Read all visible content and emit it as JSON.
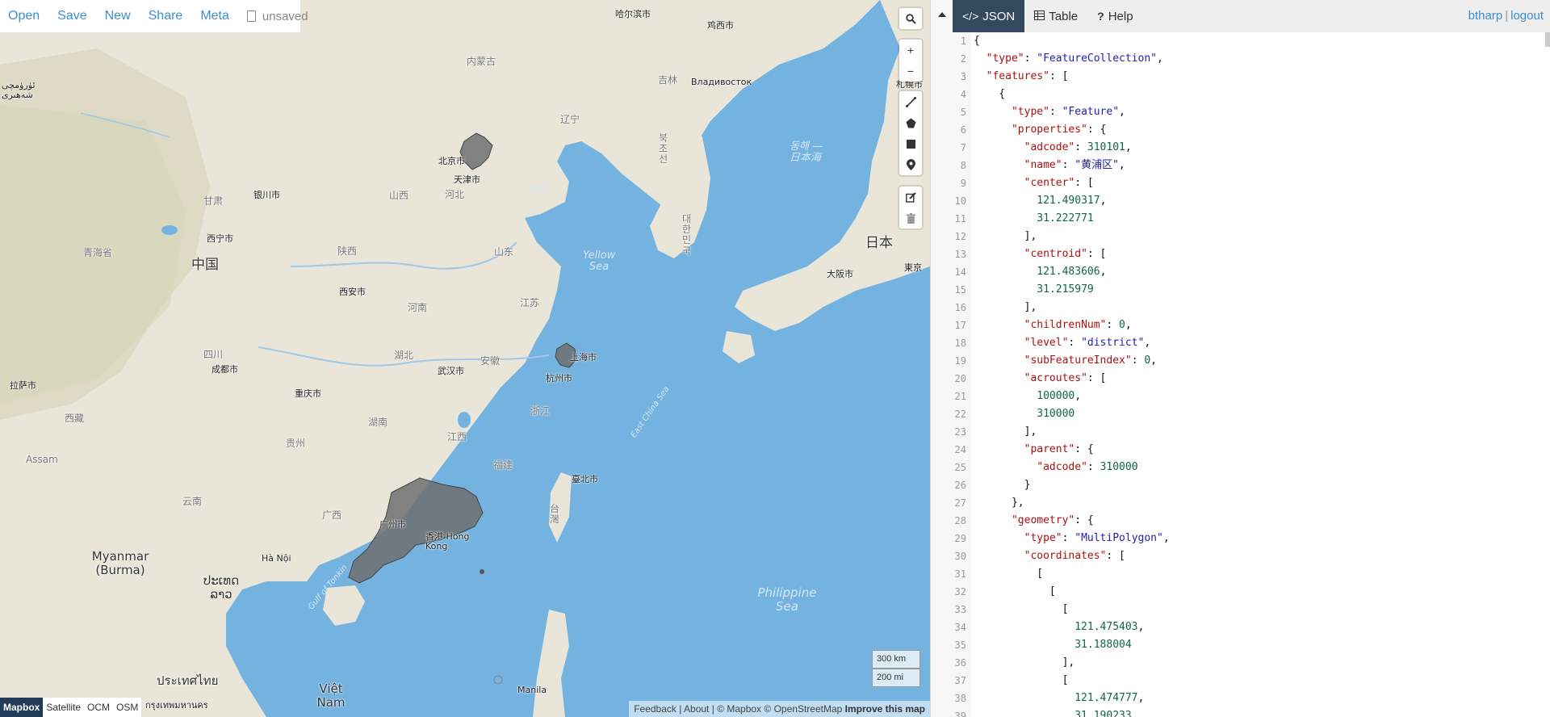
{
  "file_menu": {
    "items": [
      "Open",
      "Save",
      "New",
      "Share",
      "Meta"
    ],
    "doc_status": "unsaved"
  },
  "map": {
    "labels": {
      "harbin": "哈尔滨市",
      "jixi": "鸡西市",
      "neimenggu": "内蒙古",
      "jilin": "吉林",
      "vladivostok": "Владивосток",
      "sapporo": "札幌市",
      "liaoning": "辽宁",
      "korea_north": "북조선",
      "east_sea": "동해 — 日本海",
      "korea_south": "대한민국",
      "japan": "日本",
      "osaka": "大阪市",
      "tokyo": "東京",
      "beijing": "北京市",
      "tianjin": "天津市",
      "hebei": "河北",
      "shanxi": "山西",
      "bohai": "渤海",
      "shandong": "山东",
      "yellow_sea": "Yellow Sea",
      "yinchuan": "银川市",
      "gansu": "甘肃",
      "xining": "西宁市",
      "qinghai": "青海省",
      "china": "中国",
      "shaanxi": "陕西",
      "xian": "西安市",
      "henan": "河南",
      "jiangsu": "江苏",
      "urumqi": "ئۈرۈمچى شەھىرى",
      "sichuan": "四川",
      "chengdu": "成都市",
      "chongqing": "重庆市",
      "hubei": "湖北",
      "wuhan": "武汉市",
      "anhui": "安徽",
      "shanghai": "上海市",
      "hangzhou": "杭州市",
      "zhejiang": "浙江",
      "hunan": "湖南",
      "jiangxi": "江西",
      "fujian": "福建",
      "guizhou": "贵州",
      "lhasa": "拉萨市",
      "xizang": "西藏",
      "assam": "Assam",
      "east_china_sea": "East China Sea",
      "taipei": "臺北市",
      "taiwan": "台灣",
      "guangxi": "广西",
      "guangzhou": "广州市",
      "hongkong": "香港 Hong Kong",
      "yunnan": "云南",
      "myanmar": "Myanmar (Burma)",
      "hanoi": "Hà Nội",
      "laos": "ປະເທດລາວ",
      "gulf_tonkin": "Gulf of Tonkin",
      "philippine_sea": "Philippine Sea",
      "thailand": "ประเทศไทย",
      "vietnam": "Việt Nam",
      "manila": "Manila",
      "bangkok": "กรุงเทพมหานคร"
    },
    "tools": {
      "search": "search-icon",
      "zoom_in": "+",
      "zoom_out": "−"
    },
    "scale": {
      "km": "300 km",
      "mi": "200 mi"
    },
    "attribution": {
      "feedback": "Feedback",
      "about": "About",
      "mapbox": "© Mapbox",
      "osm": "© OpenStreetMap",
      "improve": "Improve this map"
    },
    "layers": [
      "Mapbox",
      "Satellite",
      "OCM",
      "OSM"
    ],
    "active_layer": "Mapbox",
    "colors": {
      "water": "#74b3e0",
      "land": "#ece9df",
      "polygon": "#7a7a7a"
    }
  },
  "pane": {
    "tabs": [
      {
        "label": "JSON",
        "icon": "code-icon",
        "active": true
      },
      {
        "label": "Table",
        "icon": "table-icon",
        "active": false
      },
      {
        "label": "Help",
        "icon": "question-icon",
        "active": false
      }
    ],
    "user": "btharp",
    "logout": "logout"
  },
  "editor": {
    "lines": [
      "{",
      "  \"type\": \"FeatureCollection\",",
      "  \"features\": [",
      "    {",
      "      \"type\": \"Feature\",",
      "      \"properties\": {",
      "        \"adcode\": 310101,",
      "        \"name\": \"黄浦区\",",
      "        \"center\": [",
      "          121.490317,",
      "          31.222771",
      "        ],",
      "        \"centroid\": [",
      "          121.483606,",
      "          31.215979",
      "        ],",
      "        \"childrenNum\": 0,",
      "        \"level\": \"district\",",
      "        \"subFeatureIndex\": 0,",
      "        \"acroutes\": [",
      "          100000,",
      "          310000",
      "        ],",
      "        \"parent\": {",
      "          \"adcode\": 310000",
      "        }",
      "      },",
      "      \"geometry\": {",
      "        \"type\": \"MultiPolygon\",",
      "        \"coordinates\": [",
      "          [",
      "            [",
      "              [",
      "                121.475403,",
      "                31.188004",
      "              ],",
      "              [",
      "                121.474777,",
      "                31.190233"
    ]
  }
}
